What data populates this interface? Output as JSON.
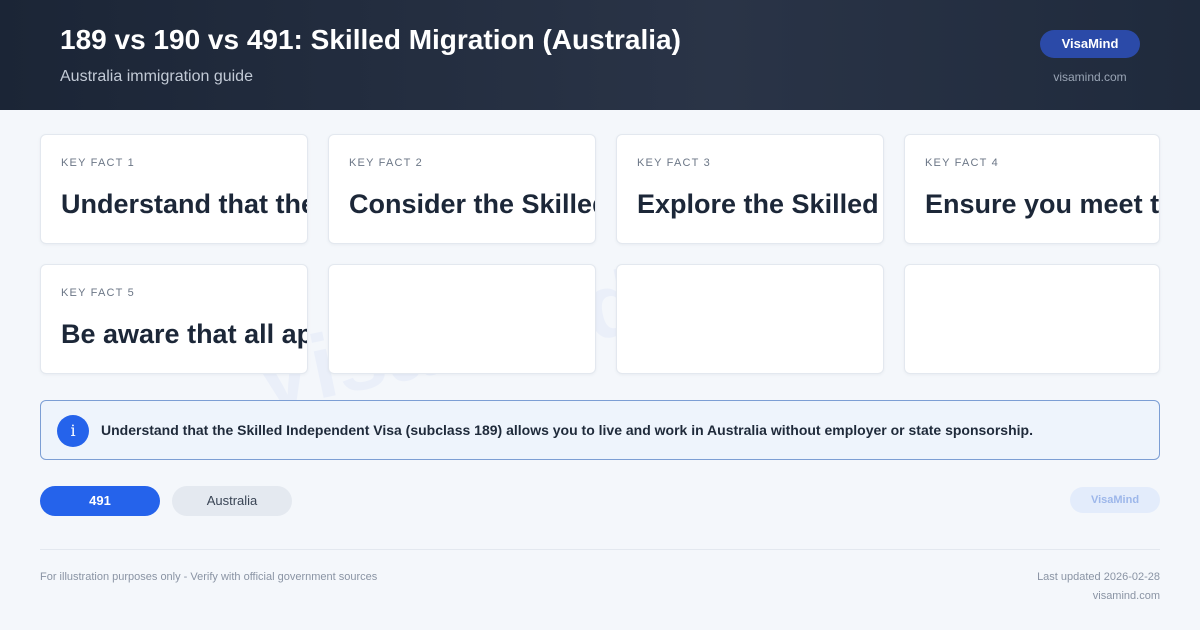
{
  "header": {
    "title": "189 vs 190 vs 491: Skilled Migration (Australia)",
    "subtitle": "Australia immigration guide",
    "brand": "VisaMind",
    "brand_url": "visamind.com"
  },
  "cards": [
    {
      "label": "KEY FACT 1",
      "text": "Understand that the Skilled Independent Visa"
    },
    {
      "label": "KEY FACT 2",
      "text": "Consider the Skilled Nominated Visa"
    },
    {
      "label": "KEY FACT 3",
      "text": "Explore the Skilled Work Regional Visa"
    },
    {
      "label": "KEY FACT 4",
      "text": "Ensure you meet the minimum points"
    },
    {
      "label": "KEY FACT 5",
      "text": "Be aware that all applicants"
    }
  ],
  "info": {
    "icon": "info-icon",
    "glyph": "i",
    "text": "Understand that the Skilled Independent Visa (subclass 189) allows you to live and work in Australia without employer or state sponsorship."
  },
  "tags": {
    "primary": "491",
    "secondary": "Australia"
  },
  "brand_badge": "VisaMind",
  "watermark": "VisaMind",
  "footer": {
    "disclaimer": "For illustration purposes only - Verify with official government sources",
    "updated": "Last updated 2026-02-28",
    "url": "visamind.com"
  },
  "colors": {
    "header_bg": "#1f2a3c",
    "accent": "#2563eb",
    "brand_pill": "#2b4aa8",
    "info_border": "#7c9ed4"
  }
}
